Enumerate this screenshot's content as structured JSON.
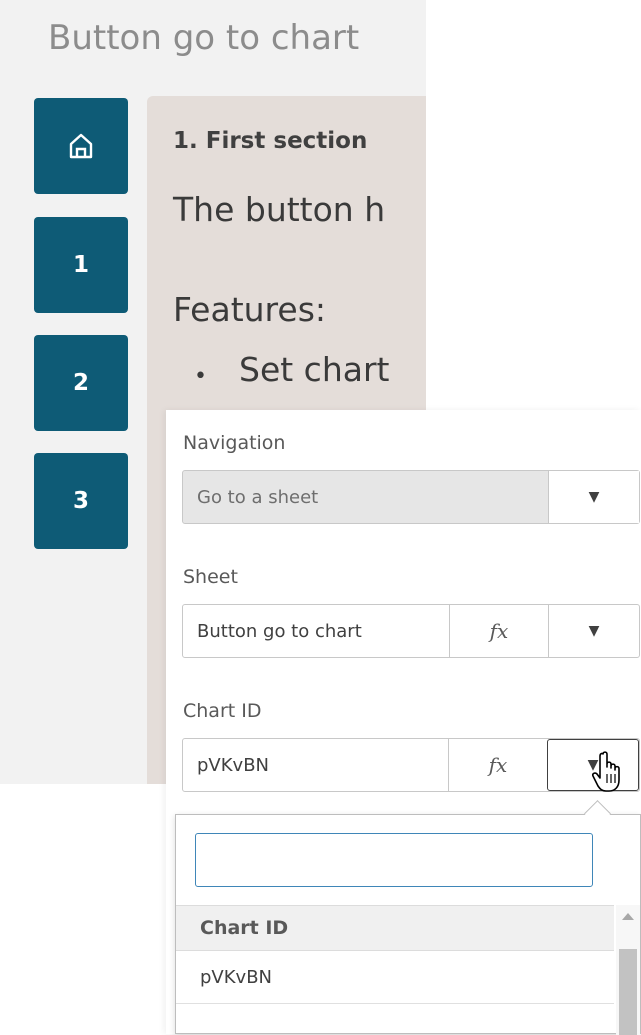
{
  "sheet": {
    "title": "Button go to chart",
    "nav_buttons": [
      "",
      "1",
      "2",
      "3"
    ],
    "section_title": "1. First section",
    "line1": "The button h",
    "line2": "Features:",
    "bullet_text": "Set chart"
  },
  "panel": {
    "navigation": {
      "label": "Navigation",
      "value": "Go to a sheet"
    },
    "sheet": {
      "label": "Sheet",
      "value": "Button go to chart",
      "fx": "fx"
    },
    "chart_id": {
      "label": "Chart ID",
      "value": "pVKvBN",
      "fx": "fx"
    }
  },
  "dropdown": {
    "search_value": "",
    "header": "Chart ID",
    "items": [
      "pVKvBN"
    ]
  },
  "colors": {
    "nav_button": "#0e5b76",
    "content_bg": "#e4ddd9",
    "search_border": "#3f86b8"
  }
}
